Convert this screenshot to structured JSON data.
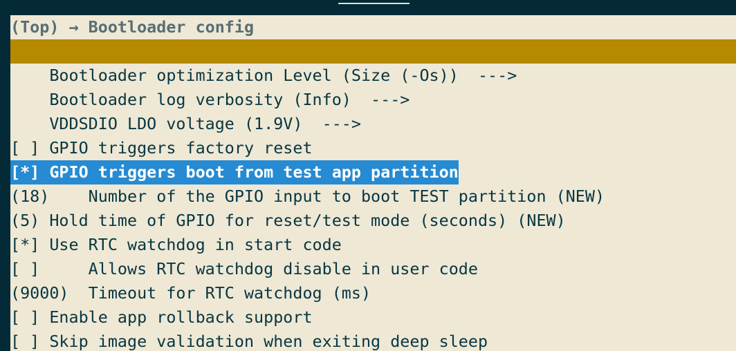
{
  "title": "(Top) → Bootloader config",
  "colors": {
    "background": "#032a36",
    "panel": "#eee8d5",
    "bar": "#b58900",
    "selection": "#268bd2",
    "text": "#073642"
  },
  "menu": {
    "items": [
      {
        "text": "    Bootloader optimization Level (Size (-Os))  --->",
        "selected": false
      },
      {
        "text": "    Bootloader log verbosity (Info)  --->",
        "selected": false
      },
      {
        "text": "    VDDSDIO LDO voltage (1.9V)  --->",
        "selected": false
      },
      {
        "text": "[ ] GPIO triggers factory reset",
        "selected": false
      },
      {
        "text": "[*] GPIO triggers boot from test app partition",
        "selected": true
      },
      {
        "text": "(18)    Number of the GPIO input to boot TEST partition (NEW)",
        "selected": false
      },
      {
        "text": "(5) Hold time of GPIO for reset/test mode (seconds) (NEW)",
        "selected": false
      },
      {
        "text": "[*] Use RTC watchdog in start code",
        "selected": false
      },
      {
        "text": "[ ]     Allows RTC watchdog disable in user code",
        "selected": false
      },
      {
        "text": "(9000)  Timeout for RTC watchdog (ms)",
        "selected": false
      },
      {
        "text": "[ ] Enable app rollback support",
        "selected": false
      },
      {
        "text": "[ ] Skip image validation when exiting deep sleep",
        "selected": false
      }
    ]
  }
}
